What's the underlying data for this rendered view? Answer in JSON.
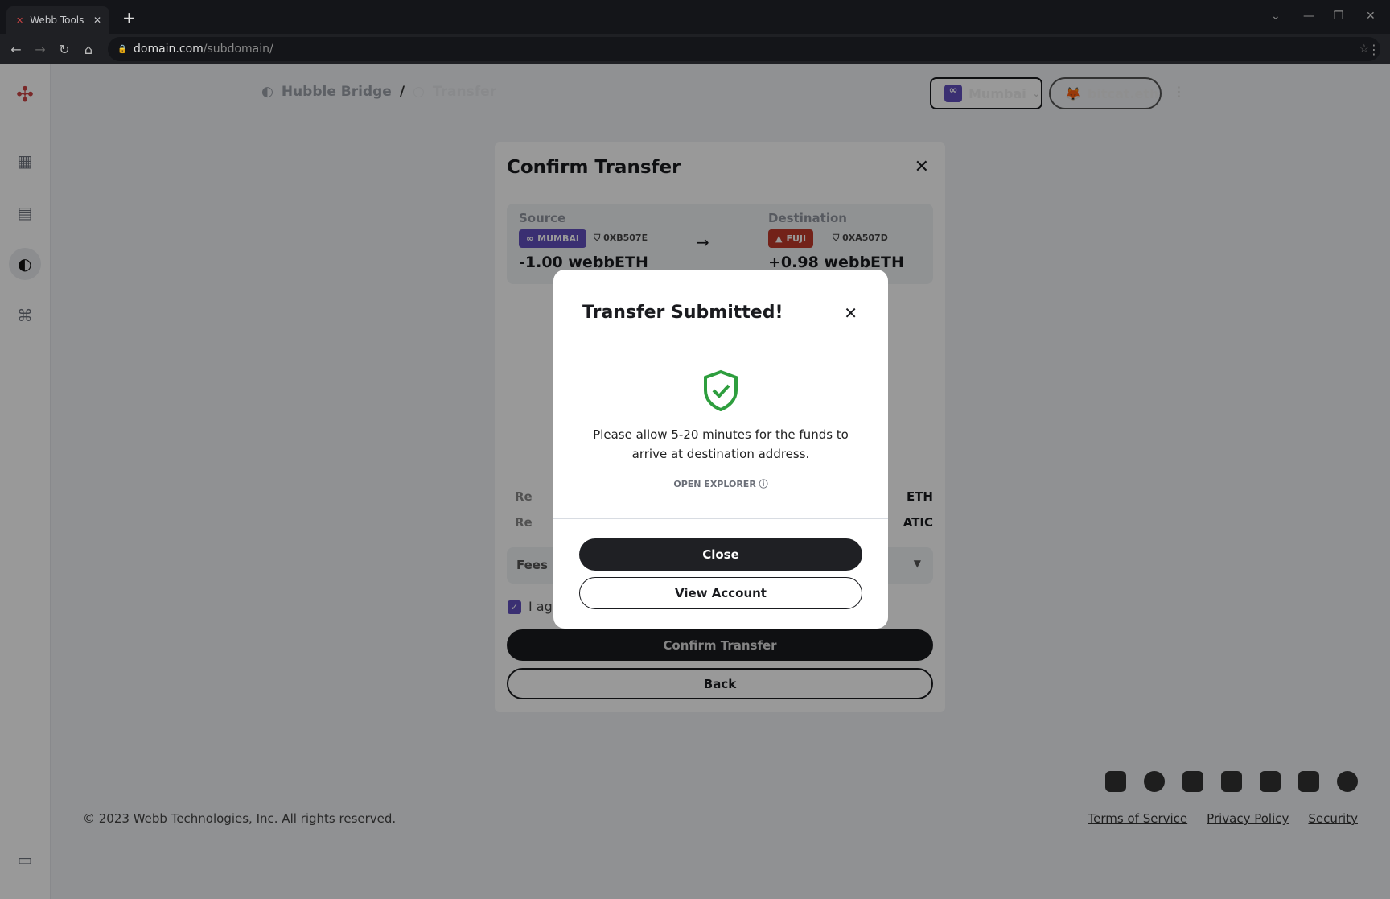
{
  "browser": {
    "tab_title": "Webb Tools",
    "url_domain": "domain.com",
    "url_path": "/subdomain/"
  },
  "breadcrumb": {
    "items": [
      "Hubble Bridge",
      "Transfer"
    ],
    "separator": "/"
  },
  "header": {
    "chain": "Mumbai",
    "wallet": "bitcat.eth"
  },
  "confirm": {
    "title": "Confirm Transfer",
    "source": {
      "label": "Source",
      "chain": "MUMBAI",
      "address": "0XB507E",
      "amount": "-1.00 webbETH"
    },
    "destination": {
      "label": "Destination",
      "chain": "FUJI",
      "address": "0XA507D",
      "amount": "+0.98 webbETH"
    },
    "rows": [
      {
        "left": "Re",
        "right": "ETH"
      },
      {
        "left": "Re",
        "right": "ATIC"
      }
    ],
    "fees_label": "Fees",
    "agree_text": "I agr",
    "confirm_button": "Confirm Transfer",
    "back_button": "Back"
  },
  "modal": {
    "title": "Transfer Submitted!",
    "message": "Please allow 5-20 minutes for the funds to arrive at destination address.",
    "explorer_link": "OPEN EXPLORER",
    "close_button": "Close",
    "view_account_button": "View Account"
  },
  "footer": {
    "copyright": "© 2023 Webb Technologies, Inc. All rights reserved.",
    "links": [
      "Terms of Service",
      "Privacy Policy",
      "Security"
    ],
    "social": [
      "webb",
      "telegram",
      "discord",
      "linkedin",
      "youtube",
      "twitter",
      "github"
    ]
  },
  "colors": {
    "accent_purple": "#624fbe",
    "fuji_red": "#c0392b",
    "success_green": "#2e9e3e",
    "dark": "#1a1b1f"
  }
}
